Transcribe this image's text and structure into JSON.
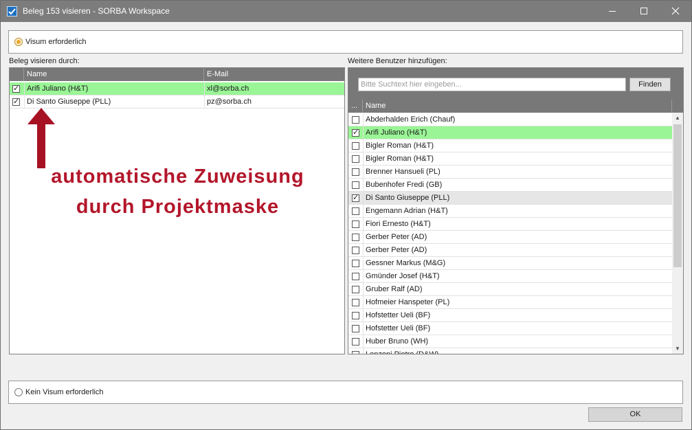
{
  "window": {
    "title": "Beleg 153 visieren - SORBA Workspace"
  },
  "options": {
    "visum_label": "Visum erforderlich",
    "kein_visum_label": "Kein Visum erforderlich"
  },
  "left": {
    "heading": "Beleg visieren durch:",
    "columns": [
      "Name",
      "E-Mail"
    ],
    "rows": [
      {
        "name": "Arifi Juliano (H&T)",
        "email": "xl@sorba.ch",
        "checked": true,
        "selected": true
      },
      {
        "name": "Di Santo Giuseppe (PLL)",
        "email": "pz@sorba.ch",
        "checked": true,
        "selected": false
      }
    ]
  },
  "annotation": {
    "line1": "automatische Zuweisung",
    "line2": "durch Projektmaske",
    "color": "#b3162a"
  },
  "right": {
    "heading": "Weitere Benutzer hinzufügen:",
    "search_placeholder": "Bitte Suchtext hier eingeben...",
    "find_label": "Finden",
    "columns": [
      "...",
      "Name"
    ],
    "rows": [
      {
        "name": "Abderhalden Erich (Chauf)",
        "checked": false
      },
      {
        "name": "Arifi Juliano (H&T)",
        "checked": true,
        "selected": true
      },
      {
        "name": "Bigler Roman (H&T)",
        "checked": false
      },
      {
        "name": "Bigler Roman (H&T)",
        "checked": false
      },
      {
        "name": "Brenner Hansueli (PL)",
        "checked": false
      },
      {
        "name": "Bubenhofer Fredi (GB)",
        "checked": false
      },
      {
        "name": "Di Santo Giuseppe (PLL)",
        "checked": true,
        "highlight": true
      },
      {
        "name": "Engemann Adrian (H&T)",
        "checked": false
      },
      {
        "name": "Fiori Ernesto (H&T)",
        "checked": false
      },
      {
        "name": "Gerber Peter (AD)",
        "checked": false
      },
      {
        "name": "Gerber Peter (AD)",
        "checked": false
      },
      {
        "name": "Gessner Markus (M&G)",
        "checked": false
      },
      {
        "name": "Gmünder Josef (H&T)",
        "checked": false
      },
      {
        "name": "Gruber Ralf (AD)",
        "checked": false
      },
      {
        "name": "Hofmeier Hanspeter (PL)",
        "checked": false
      },
      {
        "name": "Hofstetter Ueli (BF)",
        "checked": false
      },
      {
        "name": "Hofstetter Ueli (BF)",
        "checked": false
      },
      {
        "name": "Huber Bruno (WH)",
        "checked": false
      },
      {
        "name": "Lonzoni Pietro (D&W)",
        "checked": false
      }
    ]
  },
  "footer": {
    "ok_label": "OK"
  }
}
